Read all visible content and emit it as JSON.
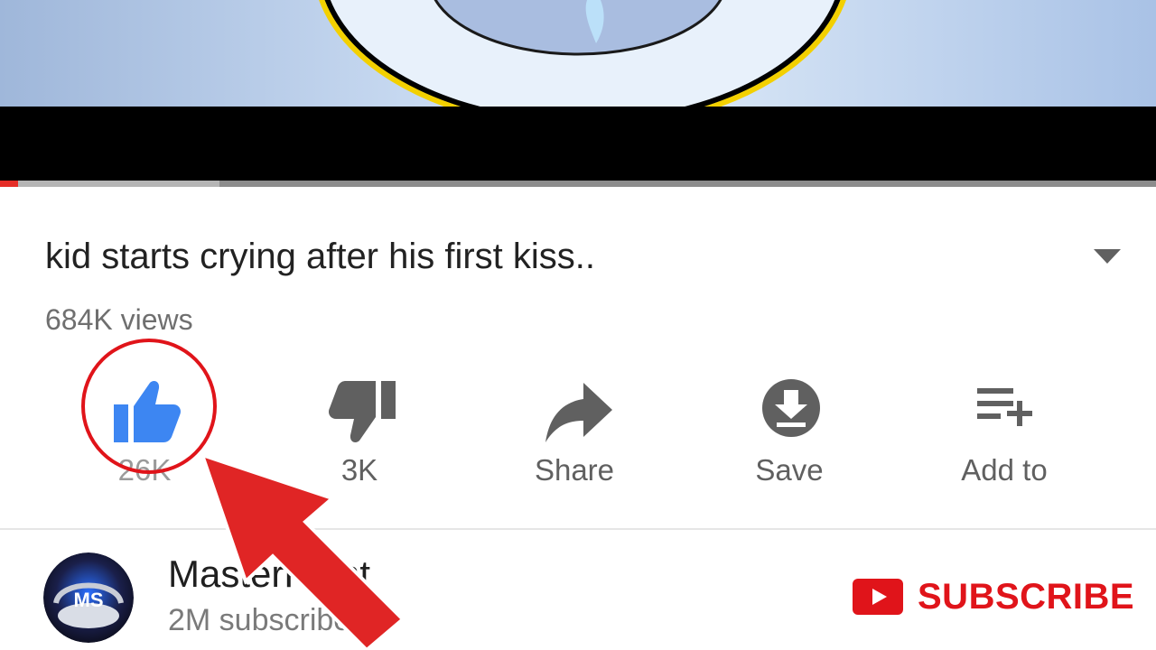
{
  "video": {
    "progress_played_fraction": 0.016,
    "progress_buffered_fraction": 0.19
  },
  "title": "kid starts crying after his first kiss..",
  "views": "684K views",
  "actions": [
    {
      "name": "like",
      "label": "26K",
      "icon": "thumbs-up-icon"
    },
    {
      "name": "dislike",
      "label": "3K",
      "icon": "thumbs-down-icon"
    },
    {
      "name": "share",
      "label": "Share",
      "icon": "share-icon"
    },
    {
      "name": "save",
      "label": "Save",
      "icon": "download-icon"
    },
    {
      "name": "add-to",
      "label": "Add to",
      "icon": "playlist-add-icon"
    }
  ],
  "channel": {
    "name": "MasterPoint",
    "subscribers": "2M subscribers",
    "avatar_text": "MS",
    "subscribe_label": "SUBSCRIBE"
  },
  "colors": {
    "accent_red": "#e0141a",
    "like_blue": "#3d86f2",
    "icon_gray": "#606060"
  }
}
